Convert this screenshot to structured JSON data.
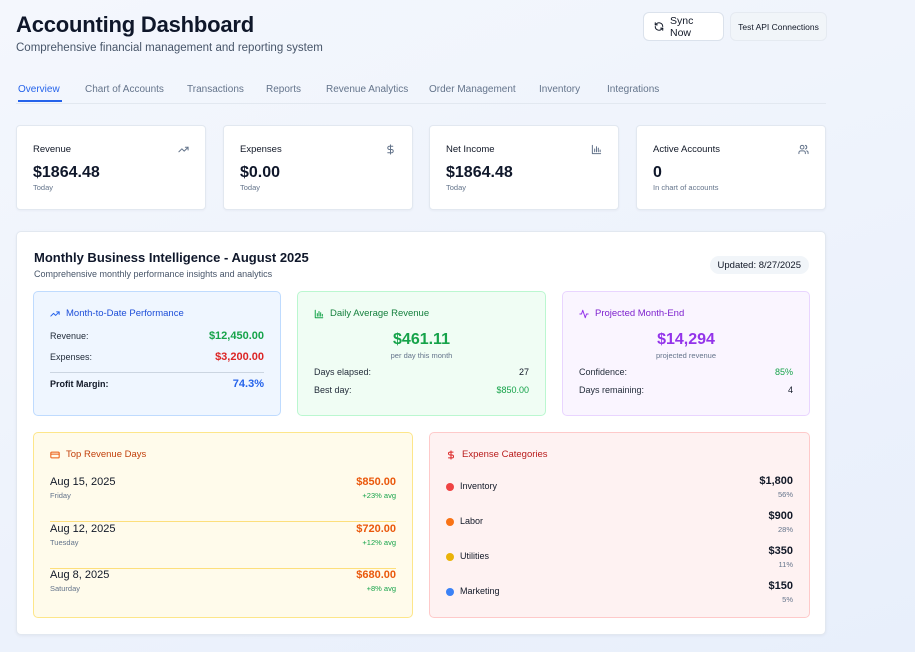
{
  "header": {
    "title": "Accounting Dashboard",
    "subtitle": "Comprehensive financial management and reporting system",
    "sync_label": "Sync Now",
    "test_label": "Test API Connections"
  },
  "tabs": [
    {
      "label": "Overview",
      "active": true
    },
    {
      "label": "Chart of Accounts",
      "active": false
    },
    {
      "label": "Transactions",
      "active": false
    },
    {
      "label": "Reports",
      "active": false
    },
    {
      "label": "Revenue Analytics",
      "active": false
    },
    {
      "label": "Order Management",
      "active": false
    },
    {
      "label": "Inventory",
      "active": false
    },
    {
      "label": "Integrations",
      "active": false
    }
  ],
  "stats": [
    {
      "label": "Revenue",
      "value": "$1864.48",
      "sub": "Today",
      "icon": "trending-up-icon"
    },
    {
      "label": "Expenses",
      "value": "$0.00",
      "sub": "Today",
      "icon": "dollar-icon"
    },
    {
      "label": "Net Income",
      "value": "$1864.48",
      "sub": "Today",
      "icon": "bar-chart-icon"
    },
    {
      "label": "Active Accounts",
      "value": "0",
      "sub": "In chart of accounts",
      "icon": "users-icon"
    }
  ],
  "bi": {
    "title": "Monthly Business Intelligence - August 2025",
    "subtitle": "Comprehensive monthly performance insights and analytics",
    "updated": "Updated: 8/27/2025",
    "mtd": {
      "title": "Month-to-Date Performance",
      "revenue_label": "Revenue:",
      "revenue_value": "$12,450.00",
      "expenses_label": "Expenses:",
      "expenses_value": "$3,200.00",
      "margin_label": "Profit Margin:",
      "margin_value": "74.3%"
    },
    "avg": {
      "title": "Daily Average Revenue",
      "value": "$461.11",
      "sub": "per day this month",
      "days_label": "Days elapsed:",
      "days_value": "27",
      "best_label": "Best day:",
      "best_value": "$850.00"
    },
    "proj": {
      "title": "Projected Month-End",
      "value": "$14,294",
      "sub": "projected revenue",
      "conf_label": "Confidence:",
      "conf_value": "85%",
      "remain_label": "Days remaining:",
      "remain_value": "4"
    },
    "top_days": {
      "title": "Top Revenue Days",
      "items": [
        {
          "date": "Aug 15, 2025",
          "weekday": "Friday",
          "amount": "$850.00",
          "change": "+23% avg"
        },
        {
          "date": "Aug 12, 2025",
          "weekday": "Tuesday",
          "amount": "$720.00",
          "change": "+12% avg"
        },
        {
          "date": "Aug 8, 2025",
          "weekday": "Saturday",
          "amount": "$680.00",
          "change": "+8% avg"
        }
      ]
    },
    "expense_categories": {
      "title": "Expense Categories",
      "items": [
        {
          "name": "Inventory",
          "amount": "$1,800",
          "pct": "56%",
          "color": "#ef4444"
        },
        {
          "name": "Labor",
          "amount": "$900",
          "pct": "28%",
          "color": "#f97316"
        },
        {
          "name": "Utilities",
          "amount": "$350",
          "pct": "11%",
          "color": "#eab308"
        },
        {
          "name": "Marketing",
          "amount": "$150",
          "pct": "5%",
          "color": "#3b82f6"
        }
      ]
    }
  }
}
